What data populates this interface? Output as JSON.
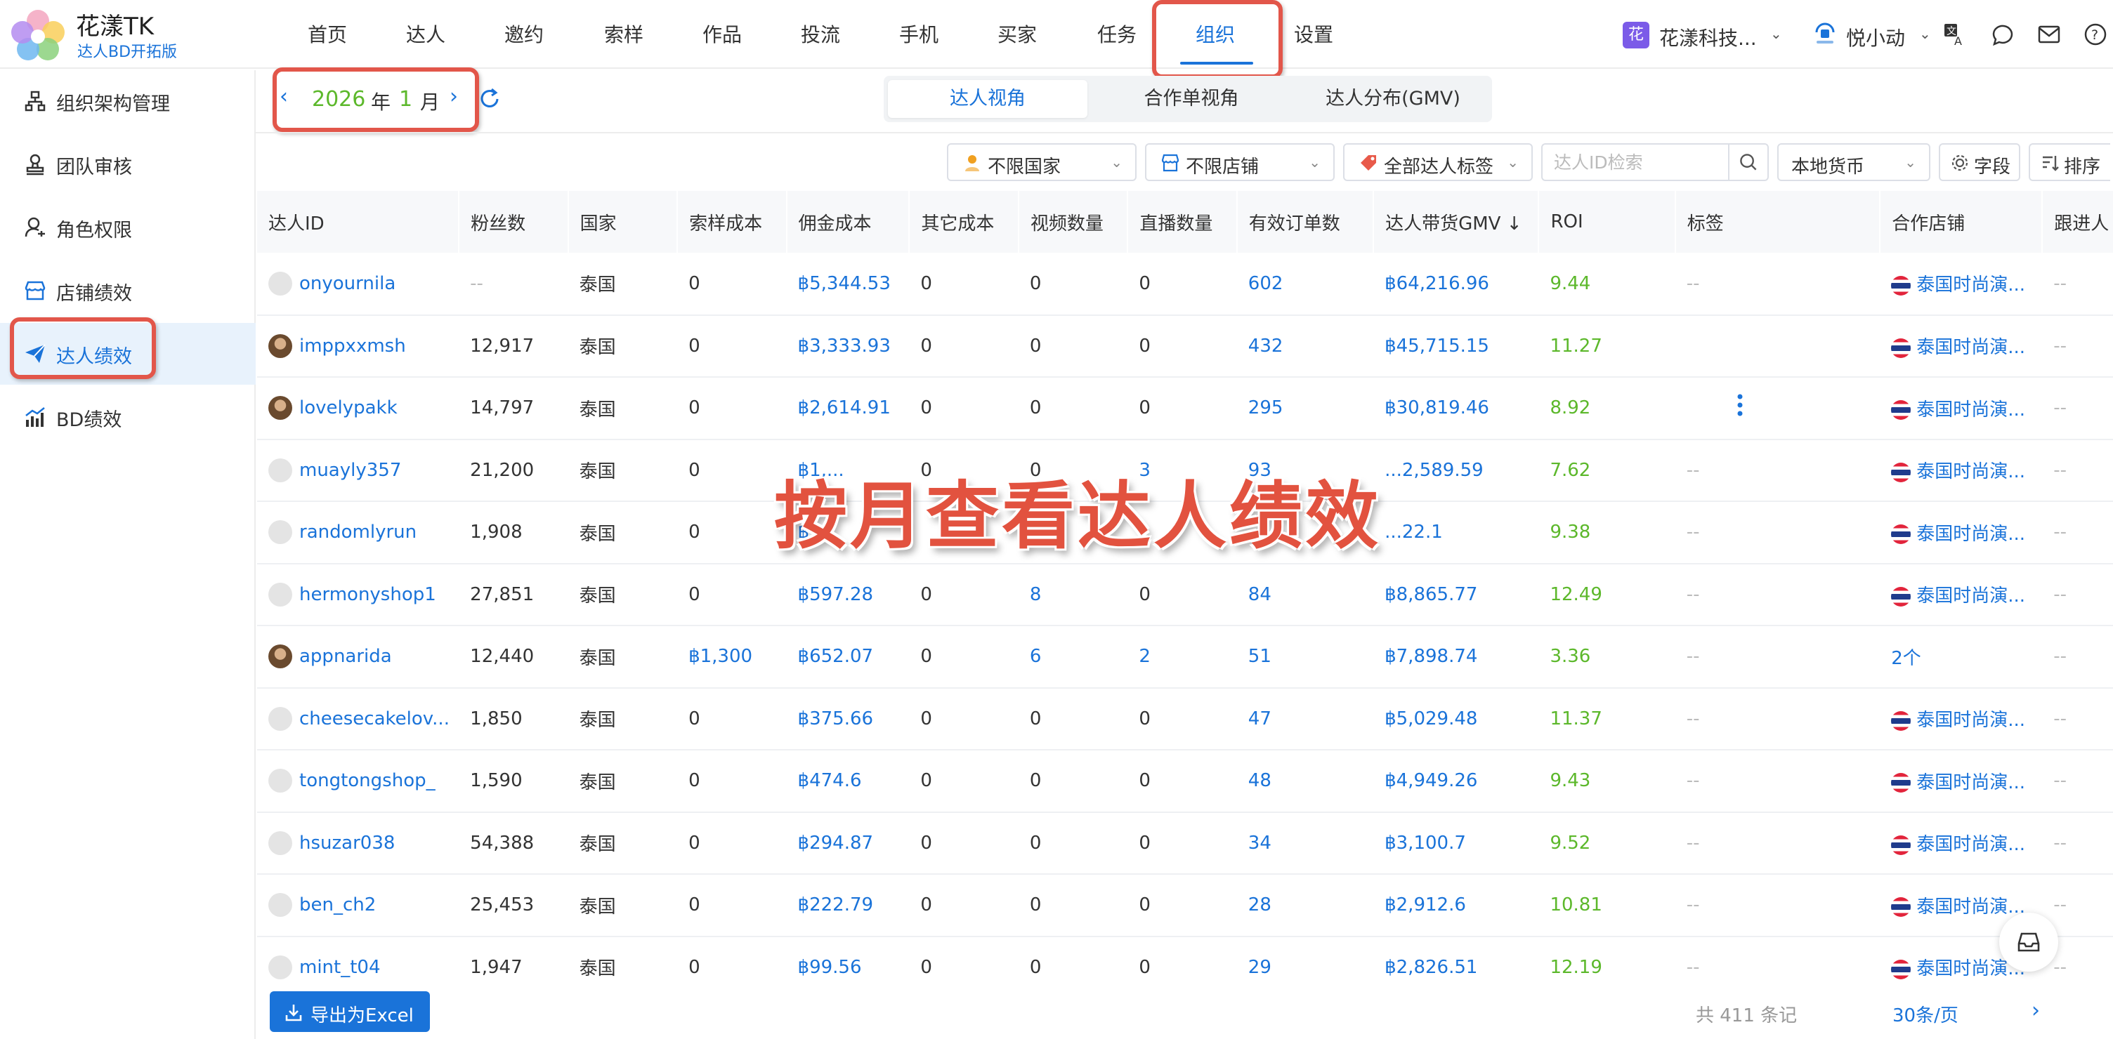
{
  "brand": {
    "title": "花漾TK",
    "subtitle": "达人BD开拓版"
  },
  "nav": {
    "items": [
      {
        "label": "首页"
      },
      {
        "label": "达人"
      },
      {
        "label": "邀约"
      },
      {
        "label": "索样"
      },
      {
        "label": "作品"
      },
      {
        "label": "投流"
      },
      {
        "label": "手机"
      },
      {
        "label": "买家"
      },
      {
        "label": "任务"
      },
      {
        "label": "组织"
      },
      {
        "label": "设置"
      }
    ],
    "active": "组织"
  },
  "header": {
    "company_badge": "花",
    "company_name": "花漾科技...",
    "user_name": "悦小动",
    "icons": [
      "translate-icon",
      "chat-icon",
      "mail-icon",
      "help-icon"
    ]
  },
  "sidebar": {
    "items": [
      {
        "label": "组织架构管理",
        "icon": "org-chart-icon"
      },
      {
        "label": "团队审核",
        "icon": "stamp-icon"
      },
      {
        "label": "角色权限",
        "icon": "user-role-icon"
      },
      {
        "label": "店铺绩效",
        "icon": "shop-icon"
      },
      {
        "label": "达人绩效",
        "icon": "paper-plane-icon",
        "active": true
      },
      {
        "label": "BD绩效",
        "icon": "bar-trend-icon"
      }
    ]
  },
  "date_picker": {
    "year": "2026",
    "year_unit": "年",
    "month": "1",
    "month_unit": "月"
  },
  "view_tabs": [
    {
      "label": "达人视角",
      "active": true
    },
    {
      "label": "合作单视角"
    },
    {
      "label": "达人分布(GMV)"
    }
  ],
  "filters": {
    "country": "不限国家",
    "shop": "不限店铺",
    "tags": "全部达人标签",
    "search_placeholder": "达人ID检索",
    "currency": "本地货币",
    "fields_label": "字段",
    "sort_label": "排序"
  },
  "table": {
    "columns": [
      "达人ID",
      "粉丝数",
      "国家",
      "索样成本",
      "佣金成本",
      "其它成本",
      "视频数量",
      "直播数量",
      "有效订单数",
      "达人带货GMV ↓",
      "ROI",
      "标签",
      "合作店铺",
      "跟进人"
    ],
    "rows": [
      {
        "id": "onyournila",
        "avatar": "default",
        "fans": "--",
        "country": "泰国",
        "sample": "0",
        "commission": "฿5,344.53",
        "other": "0",
        "videos": "0",
        "lives": "0",
        "orders": "602",
        "gmv": "฿64,216.96",
        "roi": "9.44",
        "tag": "--",
        "shop": "泰国时尚演...",
        "follow": "--"
      },
      {
        "id": "imppxxmsh",
        "avatar": "photo",
        "fans": "12,917",
        "country": "泰国",
        "sample": "0",
        "commission": "฿3,333.93",
        "other": "0",
        "videos": "0",
        "lives": "0",
        "orders": "432",
        "gmv": "฿45,715.15",
        "roi": "11.27",
        "tag": "",
        "shop": "泰国时尚演...",
        "follow": "--"
      },
      {
        "id": "lovelypakk",
        "avatar": "photo",
        "fans": "14,797",
        "country": "泰国",
        "sample": "0",
        "commission": "฿2,614.91",
        "other": "0",
        "videos": "0",
        "lives": "0",
        "orders": "295",
        "gmv": "฿30,819.46",
        "roi": "8.92",
        "tag": "",
        "shop": "泰国时尚演...",
        "follow": "--"
      },
      {
        "id": "muayly357",
        "avatar": "default",
        "fans": "21,200",
        "country": "泰国",
        "sample": "0",
        "commission": "฿1,...",
        "other": "0",
        "videos": "0",
        "lives": "3",
        "orders": "93",
        "gmv": "...2,589.59",
        "roi": "7.62",
        "tag": "--",
        "shop": "泰国时尚演...",
        "follow": "--"
      },
      {
        "id": "randomlyrun",
        "avatar": "default",
        "fans": "1,908",
        "country": "泰国",
        "sample": "0",
        "commission": "฿...",
        "other": "",
        "videos": "",
        "lives": "",
        "orders": "",
        "gmv": "...22.1",
        "roi": "9.38",
        "tag": "--",
        "shop": "泰国时尚演...",
        "follow": "--"
      },
      {
        "id": "hermonyshop1",
        "avatar": "default",
        "fans": "27,851",
        "country": "泰国",
        "sample": "0",
        "commission": "฿597.28",
        "other": "0",
        "videos": "8",
        "lives": "0",
        "orders": "84",
        "gmv": "฿8,865.77",
        "roi": "12.49",
        "tag": "--",
        "shop": "泰国时尚演...",
        "follow": "--"
      },
      {
        "id": "appnarida",
        "avatar": "photo",
        "fans": "12,440",
        "country": "泰国",
        "sample": "฿1,300",
        "commission": "฿652.07",
        "other": "0",
        "videos": "6",
        "lives": "2",
        "orders": "51",
        "gmv": "฿7,898.74",
        "roi": "3.36",
        "tag": "--",
        "shop": "2个",
        "follow": "--"
      },
      {
        "id": "cheesecakelov...",
        "avatar": "default",
        "fans": "1,850",
        "country": "泰国",
        "sample": "0",
        "commission": "฿375.66",
        "other": "0",
        "videos": "0",
        "lives": "0",
        "orders": "47",
        "gmv": "฿5,029.48",
        "roi": "11.37",
        "tag": "--",
        "shop": "泰国时尚演...",
        "follow": "--"
      },
      {
        "id": "tongtongshop_",
        "avatar": "default",
        "fans": "1,590",
        "country": "泰国",
        "sample": "0",
        "commission": "฿474.6",
        "other": "0",
        "videos": "0",
        "lives": "0",
        "orders": "48",
        "gmv": "฿4,949.26",
        "roi": "9.43",
        "tag": "--",
        "shop": "泰国时尚演...",
        "follow": "--"
      },
      {
        "id": "hsuzar038",
        "avatar": "default",
        "fans": "54,388",
        "country": "泰国",
        "sample": "0",
        "commission": "฿294.87",
        "other": "0",
        "videos": "0",
        "lives": "0",
        "orders": "34",
        "gmv": "฿3,100.7",
        "roi": "9.52",
        "tag": "--",
        "shop": "泰国时尚演...",
        "follow": "--"
      },
      {
        "id": "ben_ch2",
        "avatar": "default",
        "fans": "25,453",
        "country": "泰国",
        "sample": "0",
        "commission": "฿222.79",
        "other": "0",
        "videos": "0",
        "lives": "0",
        "orders": "28",
        "gmv": "฿2,912.6",
        "roi": "10.81",
        "tag": "--",
        "shop": "泰国时尚演...",
        "follow": "--"
      },
      {
        "id": "mint_t04",
        "avatar": "default",
        "fans": "1,947",
        "country": "泰国",
        "sample": "0",
        "commission": "฿99.56",
        "other": "0",
        "videos": "0",
        "lives": "0",
        "orders": "29",
        "gmv": "฿2,826.51",
        "roi": "12.19",
        "tag": "--",
        "shop": "泰国时尚演...",
        "follow": "--"
      }
    ]
  },
  "overlay_caption": "按月查看达人绩效",
  "footer": {
    "export_label": "导出为Excel",
    "total": "共 411 条记",
    "page_size": "30条/页"
  },
  "colors": {
    "primary": "#1a73d9",
    "green": "#5cb82b",
    "highlight": "#e2564a",
    "active_bg": "#e8f2fc"
  }
}
